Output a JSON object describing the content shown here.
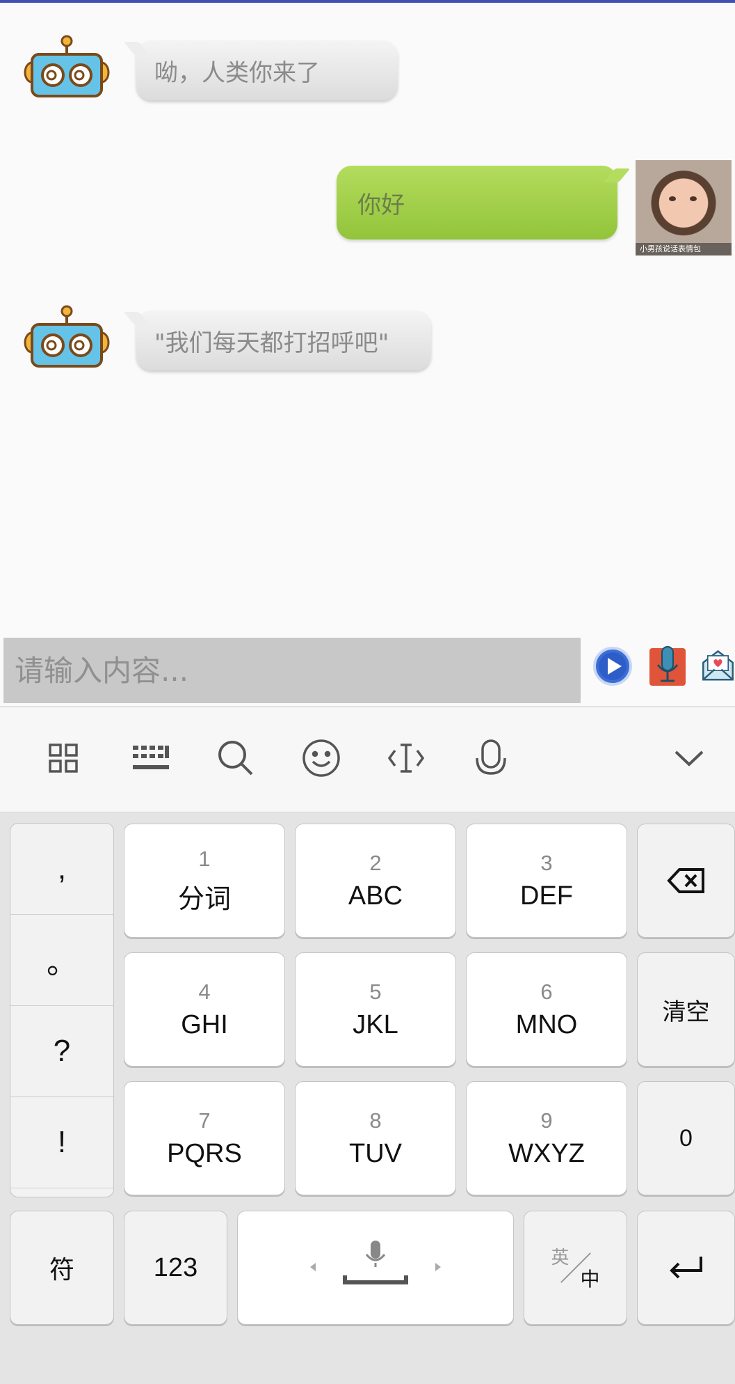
{
  "chat": {
    "messages": [
      {
        "sender": "robot",
        "text": "呦，人类你来了"
      },
      {
        "sender": "user",
        "text": "你好"
      },
      {
        "sender": "robot",
        "text": "\"我们每天都打招呼吧\""
      }
    ],
    "photo_caption": "小男孩说话表情包"
  },
  "input": {
    "placeholder": "请输入内容..."
  },
  "colors": {
    "accent_top": "#3f51b5",
    "user_bubble": "#9ccb45",
    "robot_bubble": "#e6e6e6",
    "input_bg": "#c8c8c8"
  },
  "icons": {
    "send": "play-circle-icon",
    "voice": "microphone-icon",
    "mail": "mail-heart-icon"
  },
  "keyboard": {
    "toolbar": [
      "grid-icon",
      "keyboard-icon",
      "search-icon",
      "emoji-icon",
      "cursor-icon",
      "mic-icon",
      "collapse-icon"
    ],
    "punct": [
      ",",
      "。",
      "?",
      "!"
    ],
    "keys": [
      {
        "num": "1",
        "letters": "分词"
      },
      {
        "num": "2",
        "letters": "ABC"
      },
      {
        "num": "3",
        "letters": "DEF"
      },
      {
        "num": "4",
        "letters": "GHI"
      },
      {
        "num": "5",
        "letters": "JKL"
      },
      {
        "num": "6",
        "letters": "MNO"
      },
      {
        "num": "7",
        "letters": "PQRS"
      },
      {
        "num": "8",
        "letters": "TUV"
      },
      {
        "num": "9",
        "letters": "WXYZ"
      }
    ],
    "clear_label": "清空",
    "zero_label": "0",
    "symbol_label": "符",
    "num123_label": "123",
    "lang_en": "英",
    "lang_zh": "中"
  }
}
